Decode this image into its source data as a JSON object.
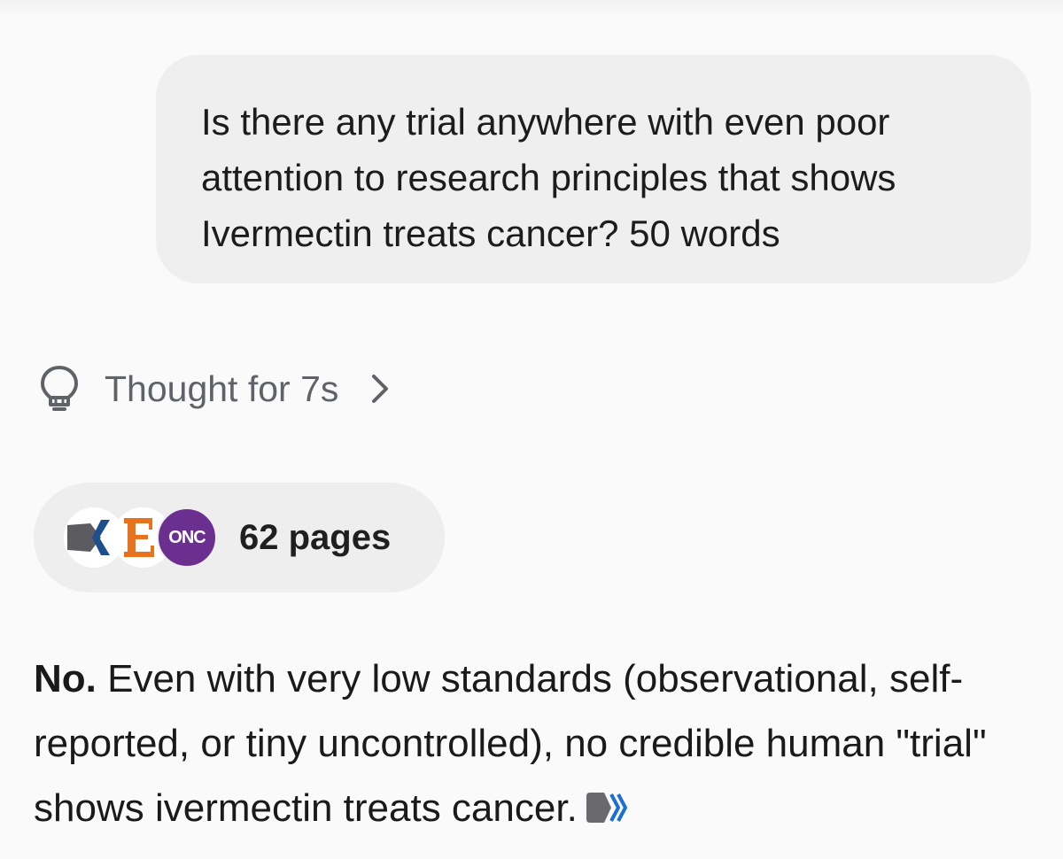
{
  "user_message": {
    "text": "Is there any trial anywhere with even poor attention to research principles that shows Ivermectin treats cancer? 50 words"
  },
  "thought": {
    "label": "Thought for 7s",
    "icon": "lightbulb-icon",
    "chevron": "chevron-right-icon"
  },
  "sources": {
    "count_label": "62 pages",
    "favicons": [
      {
        "name": "x-logo-favicon"
      },
      {
        "name": "e-logo-favicon",
        "letter": "E",
        "color": "#e8731e"
      },
      {
        "name": "onc-favicon",
        "text": "ONC",
        "color": "#6b2f8f"
      }
    ]
  },
  "answer": {
    "lead": "No.",
    "body": " Even with very low standards (observational, self-reported, or tiny uncontrolled), no credible human \"trial\" shows ivermectin treats cancer."
  },
  "colors": {
    "background": "#fafafa",
    "bubble": "#efefef",
    "pill": "#eeeeee",
    "muted_text": "#5f6368",
    "onc_purple": "#6b2f8f",
    "e_orange": "#e8731e",
    "x_blue": "#1d4f8c"
  }
}
